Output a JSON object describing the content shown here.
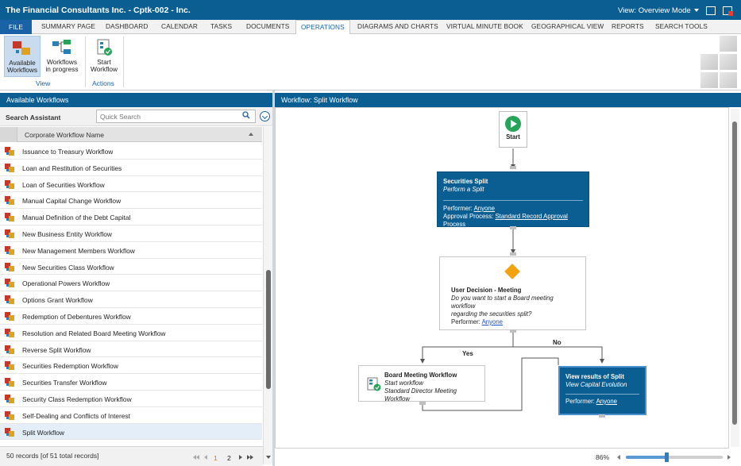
{
  "window": {
    "title": "The Financial Consultants Inc. - Cptk-002 - Inc.",
    "view_mode": "View: Overview Mode"
  },
  "tabs": [
    {
      "label": "FILE"
    },
    {
      "label": "SUMMARY PAGE"
    },
    {
      "label": "DASHBOARD"
    },
    {
      "label": "CALENDAR"
    },
    {
      "label": "TASKS"
    },
    {
      "label": "DOCUMENTS"
    },
    {
      "label": "OPERATIONS"
    },
    {
      "label": "DIAGRAMS AND CHARTS"
    },
    {
      "label": "VIRTUAL MINUTE BOOK"
    },
    {
      "label": "GEOGRAPHICAL VIEW"
    },
    {
      "label": "REPORTS"
    },
    {
      "label": "SEARCH TOOLS"
    }
  ],
  "active_tab": "OPERATIONS",
  "ribbon": {
    "available_workflows": {
      "line1": "Available",
      "line2": "Workflows"
    },
    "workflows_in_progress": {
      "line1": "Workflows",
      "line2": "in progress"
    },
    "view_group": "View",
    "start_workflow": {
      "line1": "Start",
      "line2": "Workflow"
    },
    "actions_group": "Actions"
  },
  "left_panel": {
    "title": "Available Workflows",
    "search_label": "Search Assistant",
    "search_placeholder": "Quick Search",
    "column_header": "Corporate Workflow Name",
    "rows": [
      "Issuance to Treasury Workflow",
      "Loan and Restitution of Securities",
      "Loan of Securities Workflow",
      "Manual Capital Change Workflow",
      "Manual Definition of the Debt Capital",
      "New Business Entity Workflow",
      "New Management Members Workflow",
      "New Securities Class Workflow",
      "Operational Powers Workflow",
      "Options Grant Workflow",
      "Redemption of Debentures Workflow",
      "Resolution and Related Board Meeting Workflow",
      "Reverse Split Workflow",
      "Securities Redemption Workflow",
      "Securities Transfer Workflow",
      "Security Class Redemption Workflow",
      "Self-Dealing and Conflicts of Interest",
      "Split Workflow"
    ],
    "selected_row": "Split Workflow",
    "records_text": "50 records  [of 51 total records]",
    "page_current": "1",
    "page_next": "2"
  },
  "right_panel": {
    "title": "Workflow: Split Workflow",
    "start_label": "Start",
    "securities_split": {
      "title": "Securities Split",
      "subtitle": "Perform a Split",
      "performer_label": "Performer:",
      "performer_value": "Anyone",
      "approval_label": "Approval Process:",
      "approval_value": "Standard Record Approval Process"
    },
    "decision": {
      "title": "User Decision - Meeting",
      "question_line1": "Do you want to start a Board meeting workflow",
      "question_line2": "regarding the securities split?",
      "performer_label": "Performer:",
      "performer_value": "Anyone"
    },
    "yes_label": "Yes",
    "no_label": "No",
    "board_meeting": {
      "title": "Board Meeting Workflow",
      "line1": "Start workflow",
      "line2": "Standard Director Meeting Workflow"
    },
    "view_results": {
      "title": "View results of Split",
      "subtitle": "View Capital Evolution",
      "performer_label": "Performer:",
      "performer_value": "Anyone"
    },
    "zoom": "86%",
    "zoom_level": 0.42
  },
  "colors": {
    "title_bar": "#0b5e92",
    "accent": "#1a62a6",
    "node_blue": "#0b5e92",
    "start_green": "#27a35a",
    "decision_orange": "#f2a20f"
  },
  "icons": {
    "window_restore": "window-restore-icon",
    "exit": "exit-icon",
    "search": "magnifier-icon",
    "expand": "chevron-down-circle-icon",
    "workflow_row": "workflow-icon",
    "start": "play-icon"
  }
}
